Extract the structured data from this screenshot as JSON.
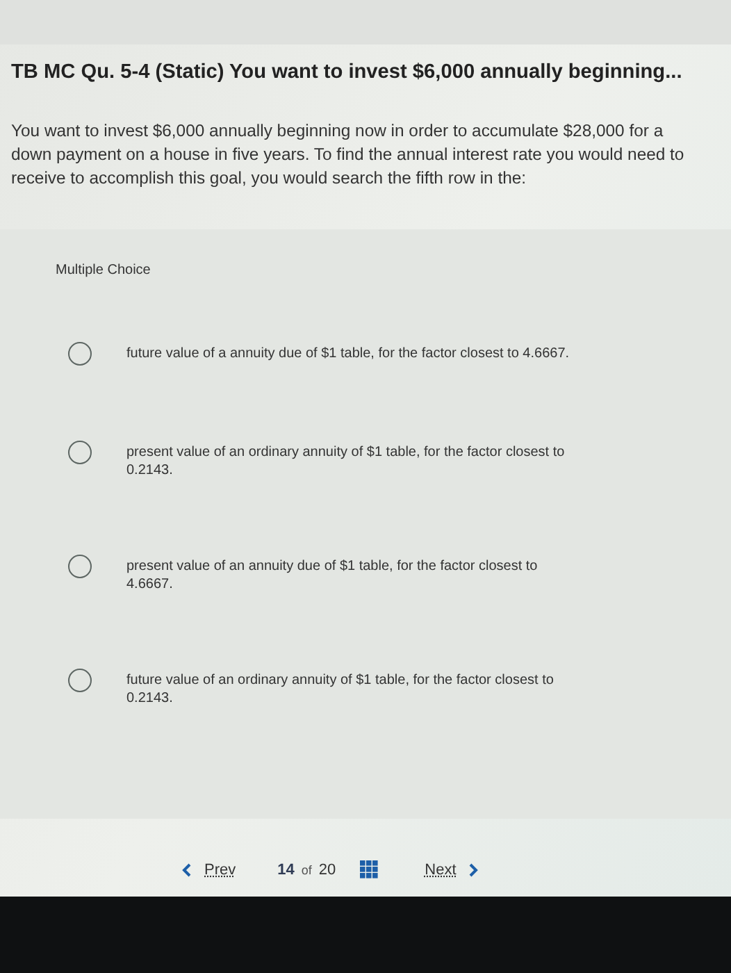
{
  "question": {
    "title": "TB MC Qu. 5-4 (Static) You want to invest $6,000 annually beginning...",
    "body": "You want to invest $6,000 annually beginning now in order to accumulate $28,000 for a down payment on a house in five years. To find the annual interest rate you would need to receive to accomplish this goal, you would search the fifth row in the:"
  },
  "multiple_choice": {
    "label": "Multiple Choice",
    "options": [
      {
        "text": "future value of a annuity due of $1 table, for the factor closest to 4.6667.",
        "selected": false
      },
      {
        "text": "present value of an ordinary annuity of $1 table, for the factor closest to 0.2143.",
        "selected": false
      },
      {
        "text": "present value of an annuity due of $1 table, for the factor closest to 4.6667.",
        "selected": false
      },
      {
        "text": "future value of an ordinary annuity of $1 table, for the factor closest to 0.2143.",
        "selected": false
      }
    ]
  },
  "pagination": {
    "prev": "Prev",
    "current": "14",
    "of": "of",
    "total": "20",
    "next": "Next"
  }
}
